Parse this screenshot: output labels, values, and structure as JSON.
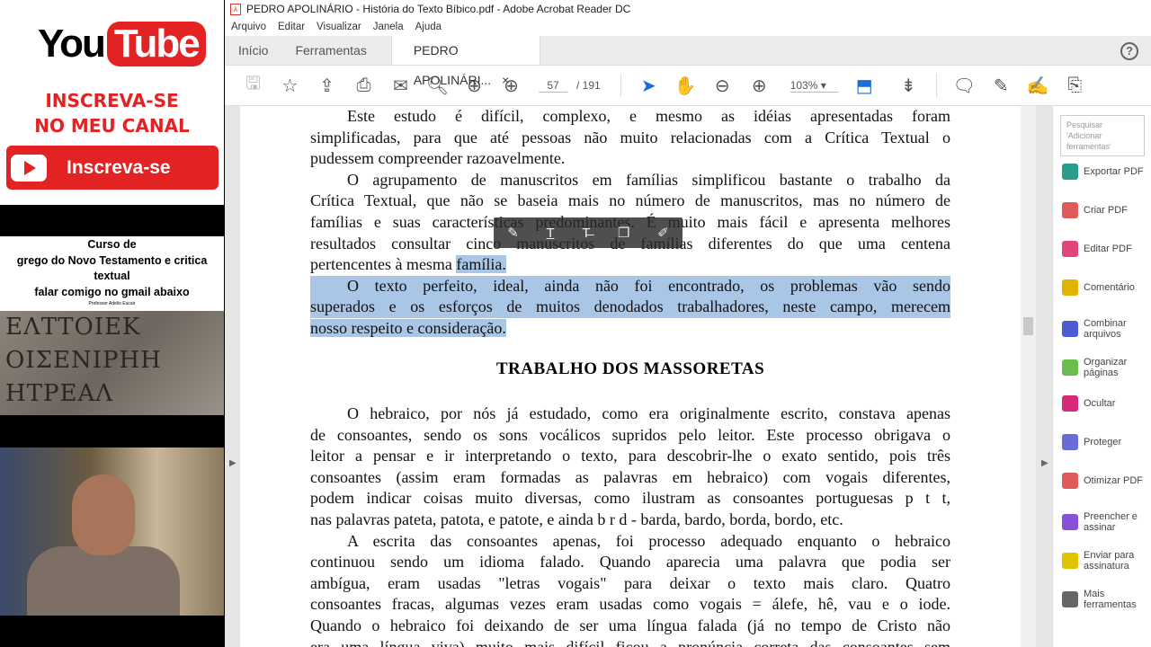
{
  "left_panel": {
    "youtube": {
      "logo_you": "You",
      "logo_tube": "Tube",
      "cta_line1": "INSCREVA-SE",
      "cta_line2": "NO MEU CANAL",
      "button": "Inscreva-se"
    },
    "course": {
      "lines": [
        "Curso de",
        "grego do Novo Testamento e critica",
        "textual",
        "falar comigo no gmail abaixo"
      ],
      "signature": "Professor Adelio Eucair"
    },
    "stone_inscription": [
      "ΕΛΤΤΟΙΕΚ",
      "ΟΙΣΕΝΙΡΗΗ",
      "ΗΤΡΕΑΛ"
    ]
  },
  "app": {
    "title": "PEDRO APOLINÁRIO - História do Texto Bíbico.pdf - Adobe Acrobat Reader DC",
    "menu": [
      "Arquivo",
      "Editar",
      "Visualizar",
      "Janela",
      "Ajuda"
    ],
    "tabs": {
      "home": "Início",
      "tools": "Ferramentas",
      "document": "PEDRO APOLINÁRI...",
      "close": "×"
    },
    "help": "?",
    "toolbar": {
      "page_current": "57",
      "page_total": "/ 191",
      "zoom": "103%"
    },
    "search_placeholder": "Pesquisar 'Adicionar ferramentas'",
    "tools": [
      {
        "label": "Exportar PDF",
        "color": "#2a9d8f"
      },
      {
        "label": "Criar PDF",
        "color": "#e05a5a"
      },
      {
        "label": "Editar PDF",
        "color": "#e0457b"
      },
      {
        "label": "Comentário",
        "color": "#e0b400"
      },
      {
        "label": "Combinar arquivos",
        "color": "#4a5bd4"
      },
      {
        "label": "Organizar páginas",
        "color": "#6abf4b"
      },
      {
        "label": "Ocultar",
        "color": "#d62b7a"
      },
      {
        "label": "Proteger",
        "color": "#6a6ad8"
      },
      {
        "label": "Otimizar PDF",
        "color": "#e05a5a"
      },
      {
        "label": "Preencher e assinar",
        "color": "#8a4fd8"
      },
      {
        "label": "Enviar para assinatura",
        "color": "#e0c400"
      },
      {
        "label": "Mais ferramentas",
        "color": "#666666"
      }
    ]
  },
  "document": {
    "para1": [
      "Este estudo é difícil, complexo, e mesmo as idéias apresentadas foram",
      "simplificadas, para que até pessoas não muito relacionadas com a Crítica Textual o",
      "pudessem compreender razoavelmente."
    ],
    "para2": [
      "O agrupamento de manuscritos em famílias simplificou bastante o trabalho da",
      "Crítica Textual, que não se baseia mais no número de manuscritos, mas no número de",
      "famílias e suas características predominantes. É muito mais fácil e apresenta melhores",
      "resultados consultar cinco manuscritos de famílias diferentes do que uma centena",
      "pertencentes à mesma "
    ],
    "para2_highlight": "família.",
    "para3": [
      "O texto perfeito, ideal, ainda não foi encontrado, os problemas vão sendo",
      "superados e os esforços de muitos denodados trabalhadores, neste campo, merecem",
      "nosso respeito e consideração."
    ],
    "heading": "TRABALHO DOS MASSORETAS",
    "para4": [
      "O hebraico, por nós já estudado, como era originalmente escrito, constava apenas",
      "de consoantes, sendo os sons vocálicos supridos pelo leitor. Este processo obrigava o",
      "leitor a pensar e ir interpretando o texto, para descobrir-lhe o exato sentido, pois três",
      "consoantes (assim eram formadas as palavras em hebraico) com vogais diferentes,",
      "podem indicar coisas muito diversas, como ilustram as consoantes portuguesas p t t,",
      "nas palavras pateta, patota, e patote, e ainda b r d - barda, bardo, borda, bordo, etc."
    ],
    "para5": [
      "A escrita das consoantes apenas, foi processo adequado enquanto o hebraico",
      "continuou sendo um idioma falado. Quando aparecia uma palavra que podia ser",
      "ambígua, eram usadas \"letras vogais\" para deixar o texto mais claro. Quatro",
      "consoantes fracas, algumas vezes eram usadas como vogais = álefe, hê, vau e o iode.",
      "Quando o hebraico foi deixando de ser uma língua falada (já no tempo de Cristo não",
      "era uma língua viva) muito mais difícil ficou a pronúncia correta das consoantes sem"
    ]
  }
}
